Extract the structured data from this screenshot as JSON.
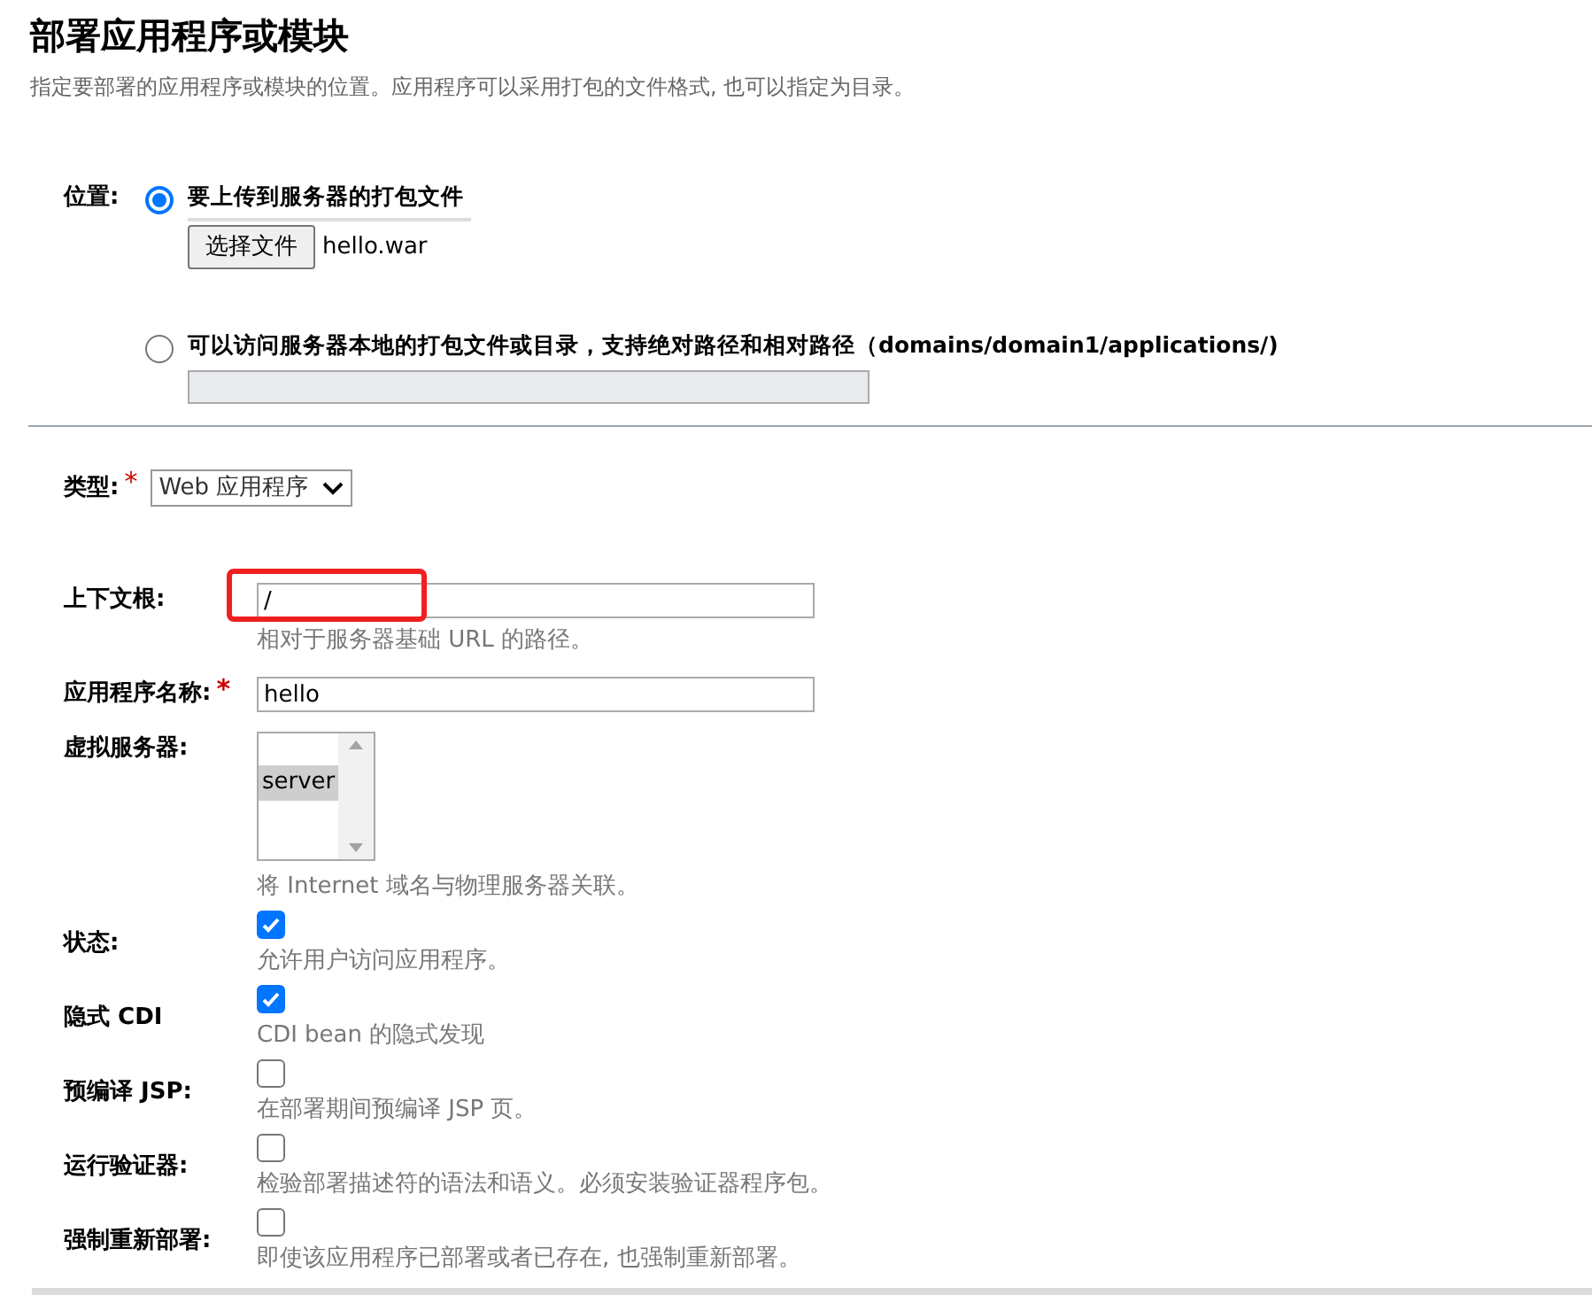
{
  "title": "部署应用程序或模块",
  "description": "指定要部署的应用程序或模块的位置。应用程序可以采用打包的文件格式, 也可以指定为目录。",
  "location": {
    "label": "位置:",
    "options": [
      {
        "kind": "upload",
        "label": "要上传到服务器的打包文件",
        "selected": true,
        "button": "选择文件",
        "file_name": "hello.war"
      },
      {
        "kind": "path",
        "label": "可以访问服务器本地的打包文件或目录，支持绝对路径和相对路径（domains/domain1/applications/)",
        "selected": false
      }
    ]
  },
  "required_mark": "*",
  "type": {
    "label": "类型:",
    "required": true,
    "value": "Web 应用程序"
  },
  "context_root": {
    "label": "上下文根:",
    "value": "/",
    "hint": "相对于服务器基础 URL 的路径。",
    "highlighted": true
  },
  "app_name": {
    "label": "应用程序名称:",
    "required": true,
    "value": "hello"
  },
  "virtual_servers": {
    "label": "虚拟服务器:",
    "items": [
      {
        "label": "server",
        "selected": true
      }
    ],
    "hint": "将 Internet 域名与物理服务器关联。"
  },
  "checkboxes": [
    {
      "label": "状态:",
      "checked": true,
      "hint": "允许用户访问应用程序。"
    },
    {
      "label": "隐式 CDI",
      "checked": true,
      "hint": "CDI bean 的隐式发现"
    },
    {
      "label": "预编译 JSP:",
      "checked": false,
      "hint": "在部署期间预编译 JSP 页。"
    },
    {
      "label": "运行验证器:",
      "checked": false,
      "hint": "检验部署描述符的语法和语义。必须安装验证器程序包。"
    },
    {
      "label": "强制重新部署:",
      "checked": false,
      "hint": "即使该应用程序已部署或者已存在, 也强制重新部署。"
    }
  ]
}
